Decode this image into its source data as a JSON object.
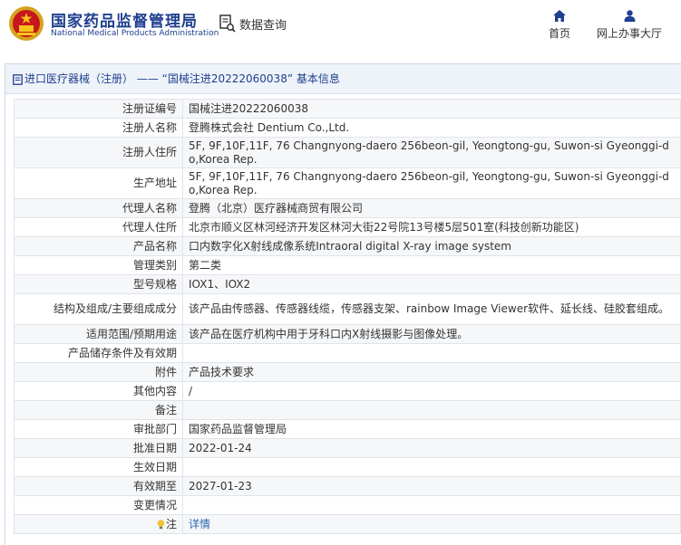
{
  "header": {
    "brand_cn": "国家药品监督管理局",
    "brand_en": "National Medical Products Administration",
    "search_label": "数据查询",
    "nav": [
      {
        "label": "首页",
        "icon": "home-icon"
      },
      {
        "label": "网上办事大厅",
        "icon": "person-icon"
      }
    ]
  },
  "panel": {
    "title": "进口医疗器械（注册） —— “国械注进20222060038” 基本信息"
  },
  "rows": [
    {
      "key": "注册证编号",
      "value": "国械注进20222060038",
      "h": 21
    },
    {
      "key": "注册人名称",
      "value": "登腾株式会社 Dentium Co.,Ltd.",
      "h": 21
    },
    {
      "key": "注册人住所",
      "value": "5F, 9F,10F,11F, 76 Changnyong-daero 256beon-gil, Yeongtong-gu, Suwon-si Gyeonggi-do,Korea Rep.",
      "h": 34
    },
    {
      "key": "生产地址",
      "value": "5F, 9F,10F,11F, 76 Changnyong-daero 256beon-gil, Yeongtong-gu, Suwon-si Gyeonggi-do,Korea Rep.",
      "h": 34
    },
    {
      "key": "代理人名称",
      "value": "登腾（北京）医疗器械商贸有限公司",
      "h": 21
    },
    {
      "key": "代理人住所",
      "value": "北京市顺义区林河经济开发区林河大街22号院13号楼5层501室(科技创新功能区)",
      "h": 21
    },
    {
      "key": "产品名称",
      "value": "口内数字化X射线成像系统Intraoral digital X-ray image system",
      "h": 21
    },
    {
      "key": "管理类别",
      "value": "第二类",
      "h": 21
    },
    {
      "key": "型号规格",
      "value": "IOX1、IOX2",
      "h": 21
    },
    {
      "key": "结构及组成/主要组成成分",
      "value": "该产品由传感器、传感器线缆，传感器支架、rainbow Image Viewer软件、延长线、硅胶套组成。",
      "h": 34
    },
    {
      "key": "适用范围/预期用途",
      "value": "该产品在医疗机构中用于牙科口内X射线摄影与图像处理。",
      "h": 21
    },
    {
      "key": "产品储存条件及有效期",
      "value": "",
      "h": 21
    },
    {
      "key": "附件",
      "value": "产品技术要求",
      "h": 21
    },
    {
      "key": "其他内容",
      "value": "/",
      "h": 21
    },
    {
      "key": "备注",
      "value": "",
      "h": 21
    },
    {
      "key": "审批部门",
      "value": "国家药品监督管理局",
      "h": 21
    },
    {
      "key": "批准日期",
      "value": "2022-01-24",
      "h": 21
    },
    {
      "key": "生效日期",
      "value": "",
      "h": 21
    },
    {
      "key": "有效期至",
      "value": "2027-01-23",
      "h": 21
    },
    {
      "key": "变更情况",
      "value": "",
      "h": 21
    }
  ],
  "note": {
    "key": "注",
    "value": "详情"
  }
}
